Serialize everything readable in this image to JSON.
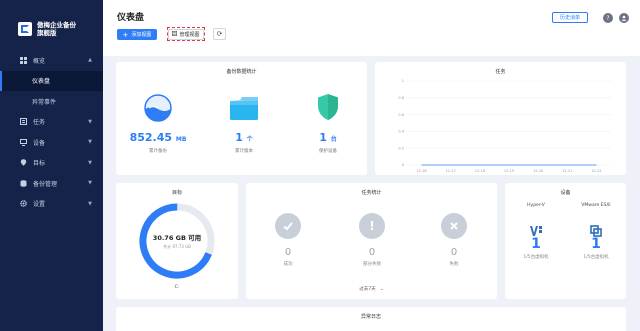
{
  "brand": {
    "line1": "傲梅企业备份",
    "line2": "旗舰版"
  },
  "sidebar": {
    "items": [
      {
        "label": "概览",
        "icon": "grid-icon"
      },
      {
        "label": "仪表盘"
      },
      {
        "label": "异常事件"
      },
      {
        "label": "任务",
        "icon": "task-icon"
      },
      {
        "label": "设备",
        "icon": "device-icon"
      },
      {
        "label": "目标",
        "icon": "target-icon"
      },
      {
        "label": "备份管理",
        "icon": "backup-manage-icon"
      },
      {
        "label": "设置",
        "icon": "gear-icon"
      }
    ]
  },
  "header": {
    "title": "仪表盘",
    "add_label": "添加视图",
    "manage_label": "管理视图",
    "history_label": "历史消单"
  },
  "backup_stats": {
    "title": "备份数据统计",
    "size_value": "852.45",
    "size_unit": "MB",
    "size_label": "累计备份",
    "versions_value": "1",
    "versions_unit": "个",
    "versions_label": "累计版本",
    "devices_value": "1",
    "devices_unit": "台",
    "devices_label": "保护设备"
  },
  "tasks_chart": {
    "title": "任务",
    "chart_data": {
      "type": "line",
      "categories": [
        "12-16",
        "12-17",
        "12-18",
        "12-19",
        "12-20",
        "12-21",
        "12-22"
      ],
      "yticks": [
        "1",
        "0.8",
        "0.6",
        "0.4",
        "0.2",
        "0"
      ],
      "ylim": [
        0,
        1
      ],
      "series": [
        {
          "values": [
            0,
            0,
            0,
            0,
            0,
            0,
            0
          ]
        }
      ]
    }
  },
  "target": {
    "title": "目标",
    "free_value": "30.76 GB 可用",
    "total_label": "共计 97.73 GB",
    "used_fraction": 0.31,
    "footer": "C:"
  },
  "task_stats": {
    "title": "任务统计",
    "items": [
      {
        "icon": "check-icon",
        "value": "0",
        "label": "成功"
      },
      {
        "icon": "exclamation-icon",
        "value": "0",
        "label": "部分失败"
      },
      {
        "icon": "close-icon",
        "value": "0",
        "label": "失败"
      }
    ],
    "period": "过去7天"
  },
  "devices": {
    "title": "设备",
    "items": [
      {
        "name": "Hyper-V",
        "value": "1",
        "label": "1/5台虚拟机"
      },
      {
        "name": "VMware ESXi",
        "value": "1",
        "label": "1/5台虚拟机"
      }
    ]
  },
  "events": {
    "title": "异常日志"
  },
  "colors": {
    "accent": "#2e7cf6",
    "sidebar": "#15224a",
    "shield": "#36c9a7",
    "folder": "#28b5f0"
  }
}
